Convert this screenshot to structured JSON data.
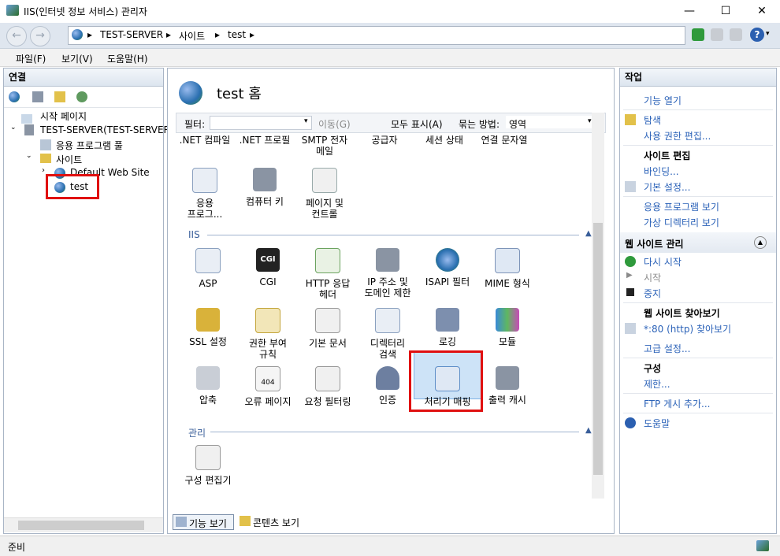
{
  "window": {
    "title": "IIS(인터넷 정보 서비스) 관리자",
    "minimize": "—",
    "maximize": "☐",
    "close": "✕"
  },
  "address": {
    "segments": [
      "TEST-SERVER",
      "사이트",
      "test"
    ],
    "separator": "▸"
  },
  "menu": [
    "파일(F)",
    "보기(V)",
    "도움말(H)"
  ],
  "connections": {
    "header": "연결",
    "tree": {
      "start_page": "시작 페이지",
      "server": "TEST-SERVER(TEST-SERVER\\",
      "app_pools": "응용 프로그램 풀",
      "sites": "사이트",
      "default_site": "Default Web Site",
      "test": "test"
    }
  },
  "center": {
    "title": "test 홈",
    "filter_label": "필터:",
    "go_label": "이동(G)",
    "show_all_label": "모두 표시(A)",
    "group_by_label": "묶는 방법:",
    "group_by_value": "영역",
    "top_row": [
      ".NET 컴파일",
      ".NET 프로필",
      "SMTP 전자\n메일",
      "공급자",
      "세션 상태",
      "연결 문자열"
    ],
    "aspnet_row": [
      "응용\n프로그...",
      "컴퓨터 키",
      "페이지 및\n컨트롤"
    ],
    "iis_section": "IIS",
    "iis_row1": [
      "ASP",
      "CGI",
      "HTTP 응답\n헤더",
      "IP 주소 및\n도메인 제한",
      "ISAPI 필터",
      "MIME 형식"
    ],
    "iis_row2": [
      "SSL 설정",
      "권한 부여\n규칙",
      "기본 문서",
      "디렉터리\n검색",
      "로깅",
      "모듈"
    ],
    "iis_row3": [
      "압축",
      "오류 페이지",
      "요청 필터링",
      "인증",
      "처리기 매핑",
      "출력 캐시"
    ],
    "mgmt_section": "관리",
    "mgmt_row": [
      "구성 편집기"
    ],
    "cgi_icon_text": "CGI",
    "error_icon_text": "404",
    "tab_features": "기능 보기",
    "tab_content": "콘텐츠 보기"
  },
  "actions": {
    "header": "작업",
    "open_feature": "기능 열기",
    "explore": "탐색",
    "edit_permissions": "사용 권한 편집...",
    "edit_site_head": "사이트 편집",
    "bindings": "바인딩...",
    "basic_settings": "기본 설정...",
    "view_apps": "응용 프로그램 보기",
    "view_vdirs": "가상 디렉터리 보기",
    "manage_head": "웹 사이트 관리",
    "restart": "다시 시작",
    "start": "시작",
    "stop": "중지",
    "browse_head": "웹 사이트 찾아보기",
    "browse_80": "*:80 (http) 찾아보기",
    "advanced": "고급 설정...",
    "config_head": "구성",
    "limits": "제한...",
    "add_ftp": "FTP 게시 추가...",
    "help": "도움말"
  },
  "status": {
    "text": "준비"
  }
}
